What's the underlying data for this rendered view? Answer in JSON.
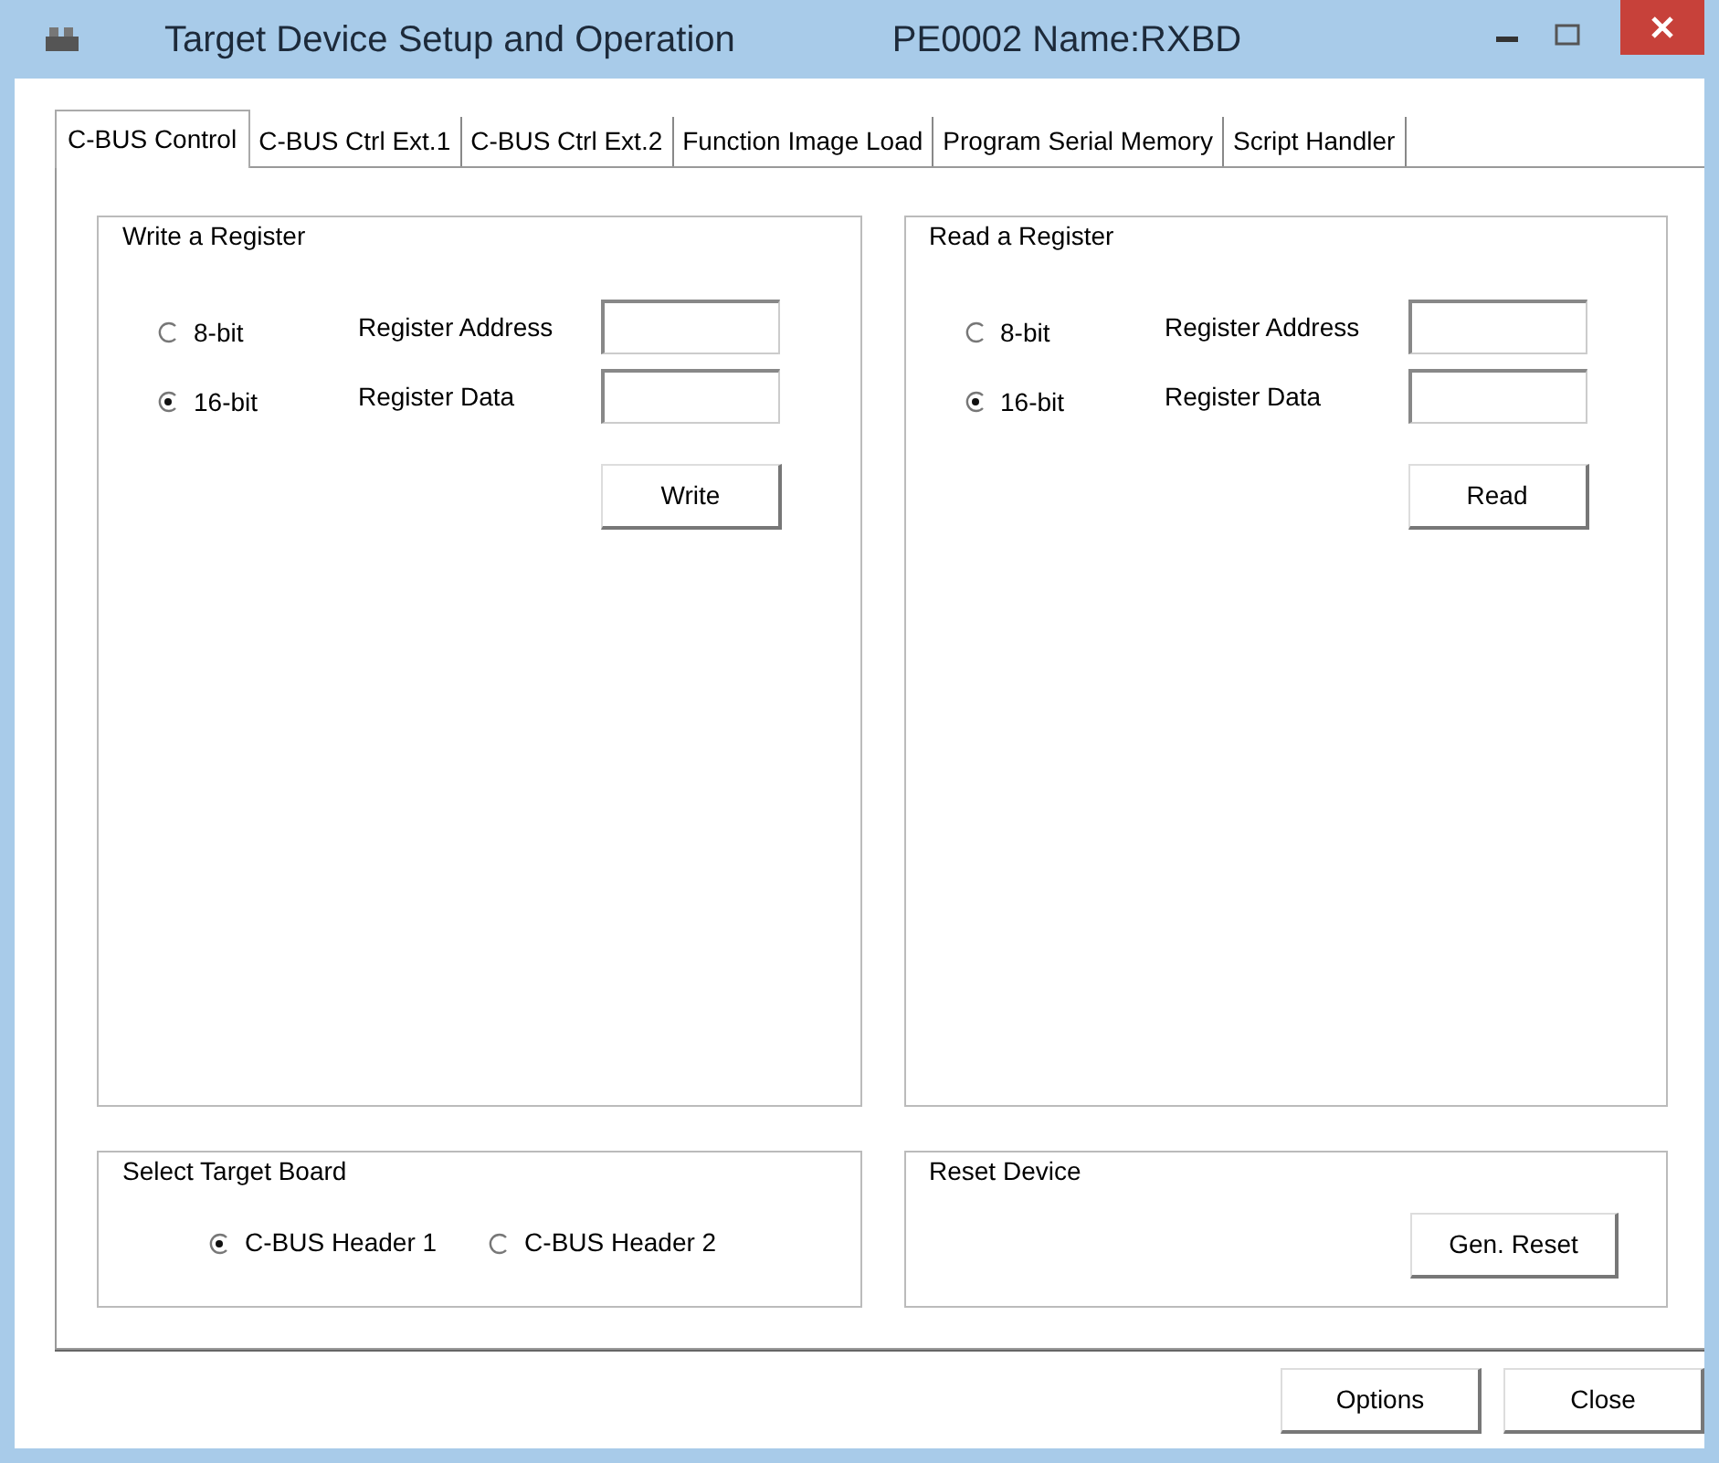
{
  "window": {
    "title": "Target Device Setup and Operation",
    "subtitle": "PE0002 Name:RXBD"
  },
  "tabs": [
    {
      "label": "C-BUS Control",
      "selected": true
    },
    {
      "label": "C-BUS Ctrl Ext.1",
      "selected": false
    },
    {
      "label": "C-BUS Ctrl Ext.2",
      "selected": false
    },
    {
      "label": "Function Image Load",
      "selected": false
    },
    {
      "label": "Program Serial Memory",
      "selected": false
    },
    {
      "label": "Script Handler",
      "selected": false
    }
  ],
  "register_groups": [
    {
      "title": "Write a Register",
      "options": [
        {
          "label": "8-bit",
          "selected": false
        },
        {
          "label": "16-bit",
          "selected": true
        }
      ],
      "fields": [
        {
          "label": "Register Address"
        },
        {
          "label": "Register Data"
        }
      ],
      "button": "Write"
    },
    {
      "title": "Read a Register",
      "options": [
        {
          "label": "8-bit",
          "selected": false
        },
        {
          "label": "16-bit",
          "selected": true
        }
      ],
      "fields": [
        {
          "label": "Register Address"
        },
        {
          "label": "Register Data"
        }
      ],
      "button": "Read"
    }
  ],
  "target_board": {
    "title": "Select Target Board",
    "options": [
      {
        "label": "C-BUS Header 1",
        "selected": true
      },
      {
        "label": "C-BUS Header 2",
        "selected": false
      }
    ]
  },
  "reset_device": {
    "title": "Reset Device",
    "button": "Gen. Reset"
  },
  "buttons": [
    "Options",
    "Close"
  ]
}
